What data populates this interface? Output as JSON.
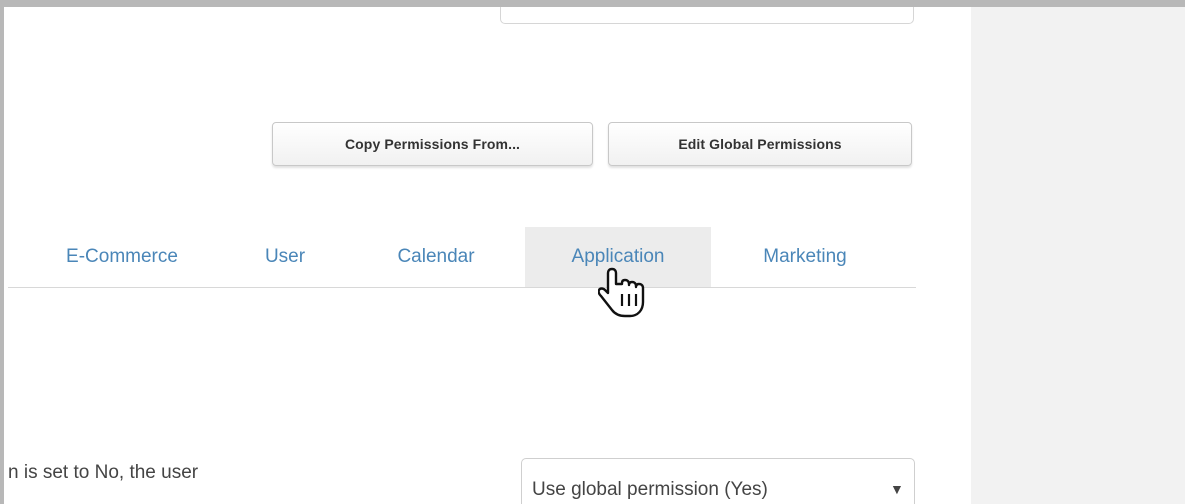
{
  "toolbar": {
    "copy_permissions_label": "Copy Permissions From...",
    "edit_global_permissions_label": "Edit Global Permissions"
  },
  "tabs": [
    {
      "label": "E-Commerce",
      "active": false
    },
    {
      "label": "User",
      "active": false
    },
    {
      "label": "Calendar",
      "active": false
    },
    {
      "label": "Application",
      "active": true
    },
    {
      "label": "Marketing",
      "active": false
    }
  ],
  "permission_row": {
    "description": "n is set to No, the user",
    "select_value": "Use global permission (Yes)",
    "select_arrow": "▼"
  },
  "colors": {
    "tab_link": "#4a86b8",
    "active_tab_bg": "#ececec",
    "right_panel_bg": "#f2f2f2"
  },
  "icons": {
    "cursor": "hand-pointer-icon"
  }
}
